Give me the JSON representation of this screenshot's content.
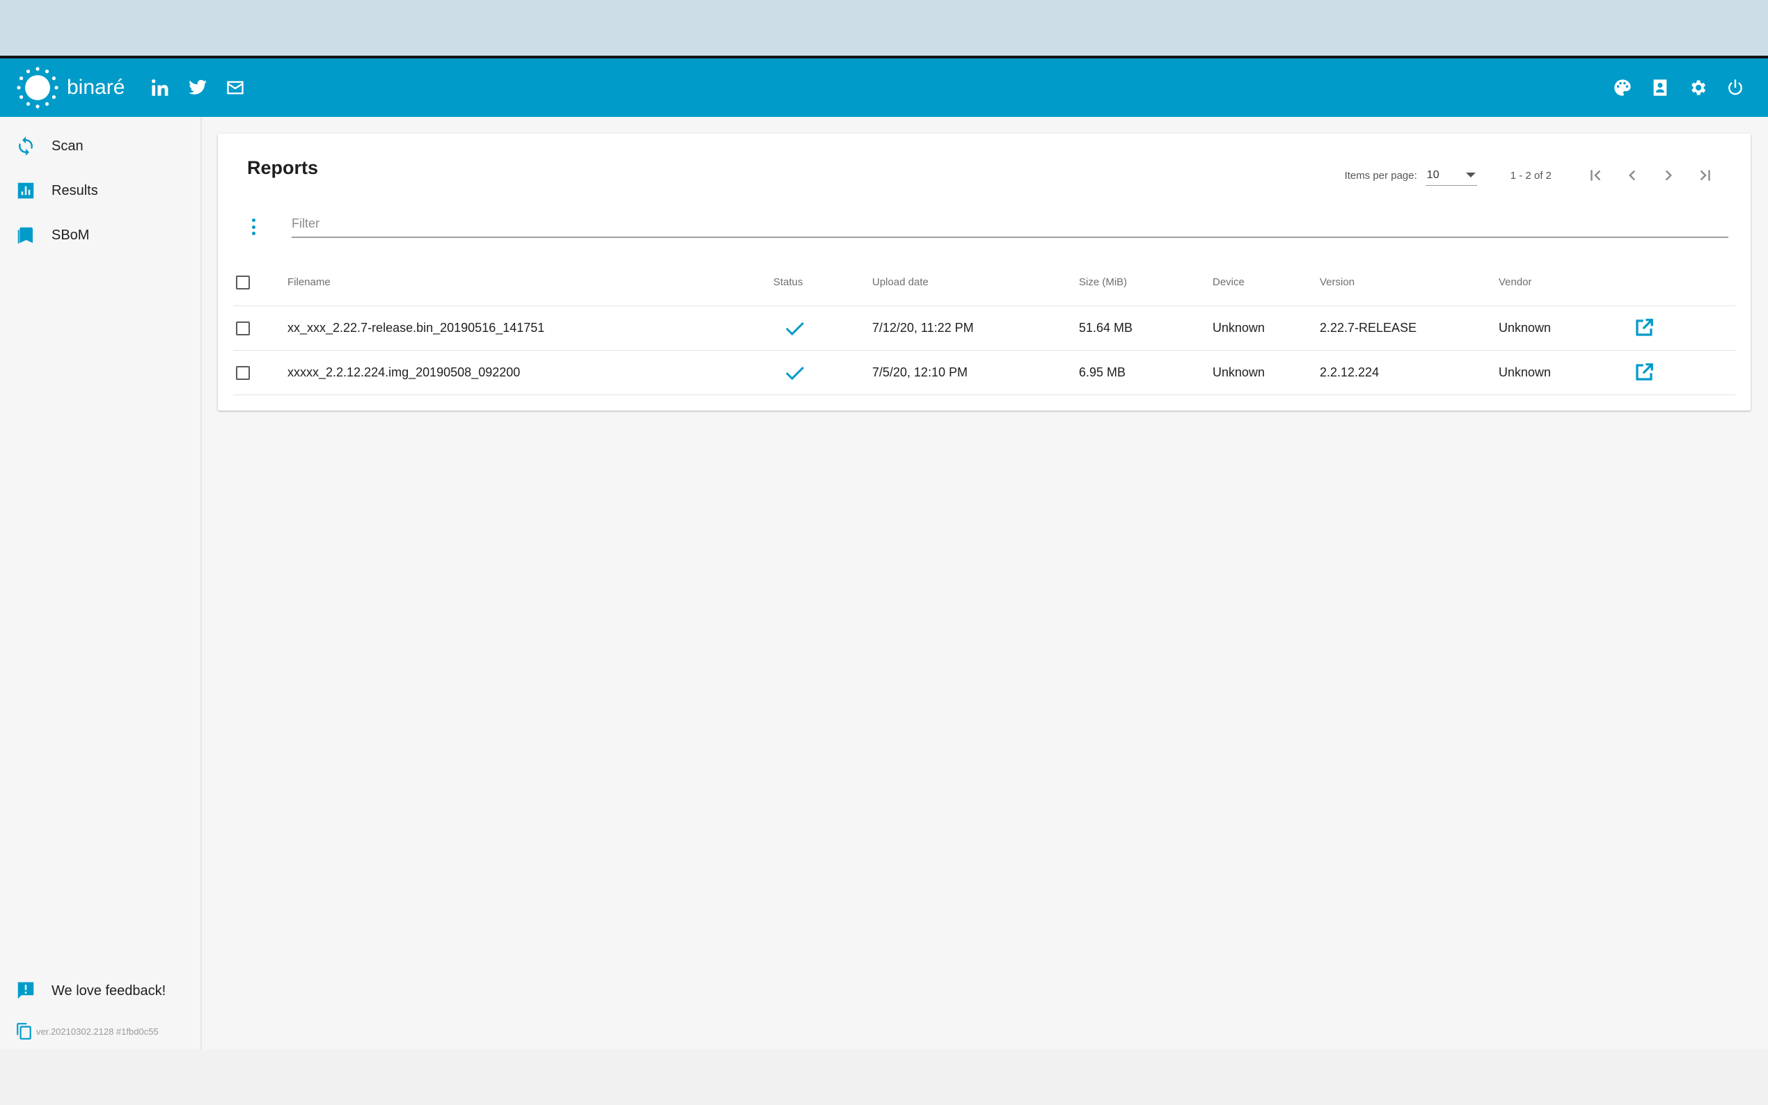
{
  "app": {
    "brand": "binaré",
    "header_icons": [
      "linkedin-icon",
      "twitter-icon",
      "mail-icon"
    ],
    "header_right_icons": [
      "palette-icon",
      "account-icon",
      "settings-icon",
      "power-icon"
    ],
    "accent_color": "#019bc9"
  },
  "sidebar": {
    "items": [
      {
        "label": "Scan",
        "icon": "sync-icon"
      },
      {
        "label": "Results",
        "icon": "bar-chart-icon"
      },
      {
        "label": "SBoM",
        "icon": "bookmark-icon"
      }
    ],
    "feedback_label": "We love feedback!",
    "version": "ver.20210302.2128 #1fbd0c55"
  },
  "reports": {
    "title": "Reports",
    "paginator": {
      "items_per_page_label": "Items per page:",
      "items_per_page_value": "10",
      "range_label": "1 - 2 of 2"
    },
    "filter_placeholder": "Filter",
    "columns": {
      "filename": "Filename",
      "status": "Status",
      "upload_date": "Upload date",
      "size": "Size (MiB)",
      "device": "Device",
      "version": "Version",
      "vendor": "Vendor"
    },
    "rows": [
      {
        "filename": "xx_xxx_2.22.7-release.bin_20190516_141751",
        "status": "done",
        "upload_date": "7/12/20, 11:22 PM",
        "size": "51.64 MB",
        "device": "Unknown",
        "version": "2.22.7-RELEASE",
        "vendor": "Unknown"
      },
      {
        "filename": "xxxxx_2.2.12.224.img_20190508_092200",
        "status": "done",
        "upload_date": "7/5/20, 12:10 PM",
        "size": "6.95 MB",
        "device": "Unknown",
        "version": "2.2.12.224",
        "vendor": "Unknown"
      }
    ]
  }
}
